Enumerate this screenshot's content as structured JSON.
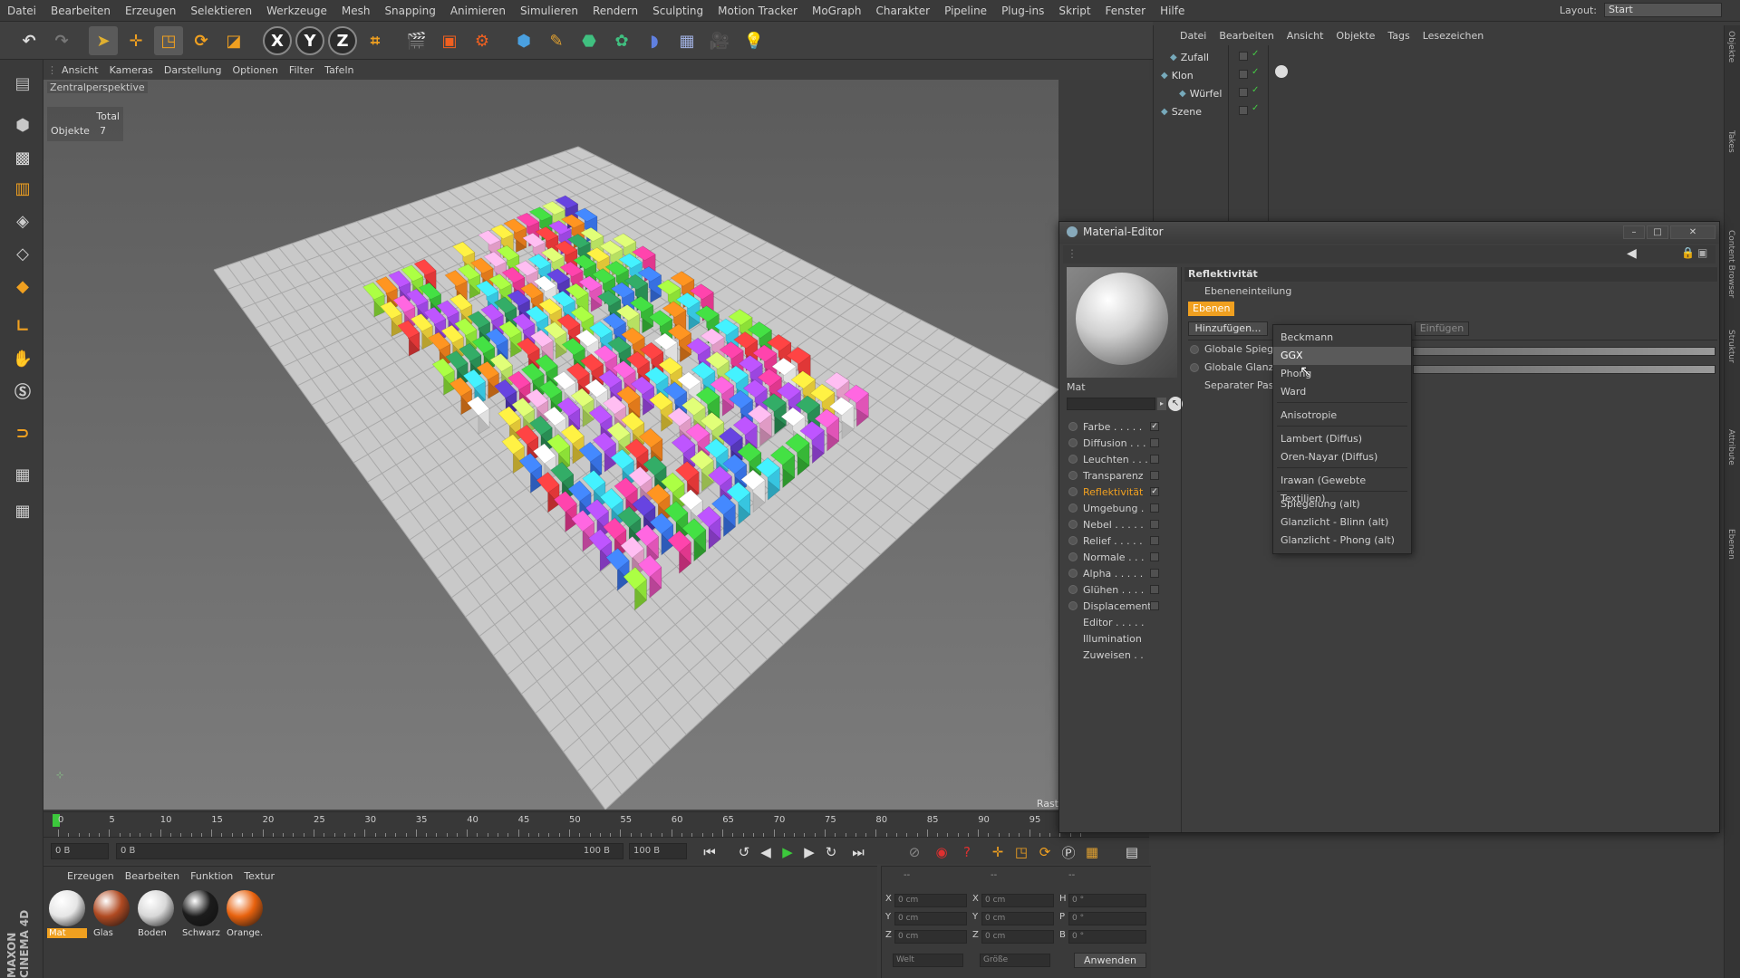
{
  "menubar": {
    "items": [
      "Datei",
      "Bearbeiten",
      "Erzeugen",
      "Selektieren",
      "Werkzeuge",
      "Mesh",
      "Snapping",
      "Animieren",
      "Simulieren",
      "Rendern",
      "Sculpting",
      "Motion Tracker",
      "MoGraph",
      "Charakter",
      "Pipeline",
      "Plug-ins",
      "Skript",
      "Fenster",
      "Hilfe"
    ],
    "layout_label": "Layout:",
    "layout_value": "Start"
  },
  "toolbar": {
    "axis_x": "X",
    "axis_y": "Y",
    "axis_z": "Z"
  },
  "viewport": {
    "menu": [
      "Ansicht",
      "Kameras",
      "Darstellung",
      "Optionen",
      "Filter",
      "Tafeln"
    ],
    "camera_label": "Zentralperspektive",
    "hud_total": "Total",
    "hud_objects_label": "Objekte",
    "hud_objects_value": "7",
    "corner_label": "Rast"
  },
  "timeline": {
    "ticks": [
      "0",
      "5",
      "10",
      "15",
      "20",
      "25",
      "30",
      "35",
      "40",
      "45",
      "50",
      "55",
      "60",
      "65",
      "70",
      "75",
      "80",
      "85",
      "90",
      "95"
    ],
    "current_frame": "0 B",
    "range_start": "0 B",
    "range_end": "100 B",
    "end_frame": "100 B"
  },
  "material_manager": {
    "menu": [
      "Erzeugen",
      "Bearbeiten",
      "Funktion",
      "Textur"
    ],
    "materials": [
      {
        "name": "Mat",
        "color": "#e6e6e6",
        "selected": true
      },
      {
        "name": "Glas",
        "color": "#b04a22",
        "selected": false
      },
      {
        "name": "Boden",
        "color": "#d8d8d8",
        "selected": false
      },
      {
        "name": "Schwarz",
        "color": "#1c1c1c",
        "selected": false
      },
      {
        "name": "Orange.",
        "color": "#e8620e",
        "selected": false
      }
    ]
  },
  "coordinates": {
    "header_left": "--",
    "header_mid": "--",
    "header_right": "--",
    "rows": [
      {
        "l1": "X",
        "v1": "0 cm",
        "l2": "X",
        "v2": "0 cm",
        "l3": "H",
        "v3": "0 °"
      },
      {
        "l1": "Y",
        "v1": "0 cm",
        "l2": "Y",
        "v2": "0 cm",
        "l3": "P",
        "v3": "0 °"
      },
      {
        "l1": "Z",
        "v1": "0 cm",
        "l2": "Z",
        "v2": "0 cm",
        "l3": "B",
        "v3": "0 °"
      }
    ],
    "mode_select": "Welt",
    "size_select": "Größe",
    "apply_button": "Anwenden"
  },
  "object_manager": {
    "menu": [
      "Datei",
      "Bearbeiten",
      "Ansicht",
      "Objekte",
      "Tags",
      "Lesezeichen"
    ],
    "objects": [
      {
        "name": "Zufall",
        "indent": 1
      },
      {
        "name": "Klon",
        "indent": 0
      },
      {
        "name": "Würfel",
        "indent": 2
      },
      {
        "name": "Szene",
        "indent": 0
      }
    ]
  },
  "right_strip": [
    "Objekte",
    "Takes",
    "Content Browser",
    "Struktur",
    "Attribute",
    "Ebenen"
  ],
  "material_editor": {
    "title": "Material-Editor",
    "material_name": "Mat",
    "channels": [
      {
        "name": "Farbe . . . . .",
        "checked": true
      },
      {
        "name": "Diffusion . . .",
        "checked": false
      },
      {
        "name": "Leuchten . . .",
        "checked": false
      },
      {
        "name": "Transparenz",
        "checked": false
      },
      {
        "name": "Reflektivität",
        "checked": true,
        "active": true
      },
      {
        "name": "Umgebung .",
        "checked": false
      },
      {
        "name": "Nebel . . . . .",
        "checked": false
      },
      {
        "name": "Relief . . . . .",
        "checked": false
      },
      {
        "name": "Normale . . .",
        "checked": false
      },
      {
        "name": "Alpha . . . . .",
        "checked": false
      },
      {
        "name": "Glühen . . . .",
        "checked": false
      },
      {
        "name": "Displacement",
        "checked": false
      },
      {
        "name": "Editor . . . . .",
        "checked": null
      },
      {
        "name": "Illumination",
        "checked": null
      },
      {
        "name": "Zuweisen . .",
        "checked": null
      }
    ],
    "section_title": "Reflektivität",
    "layer_division": "Ebeneneinteilung",
    "layers_tab": "Ebenen",
    "add_button": "Hinzufügen...",
    "insert_button": "Einfügen",
    "global_reflection": "Globale Spieg",
    "global_gloss": "Globale Glanz",
    "separate_pass": "Separater Pass"
  },
  "dropdown": {
    "items": [
      "Beckmann",
      "GGX",
      "Phong",
      "Ward",
      "Anisotropie",
      "Lambert (Diffus)",
      "Oren-Nayar (Diffus)",
      "Irawan (Gewebte Textilien)",
      "Spiegelung (alt)",
      "Glanzlicht - Blinn (alt)",
      "Glanzlicht - Phong (alt)"
    ],
    "highlighted": "GGX",
    "highlight_color": "#5a5a5a"
  },
  "branding": {
    "vertical_text": "MAXON CINEMA 4D"
  },
  "accent_color": "#f0a020"
}
